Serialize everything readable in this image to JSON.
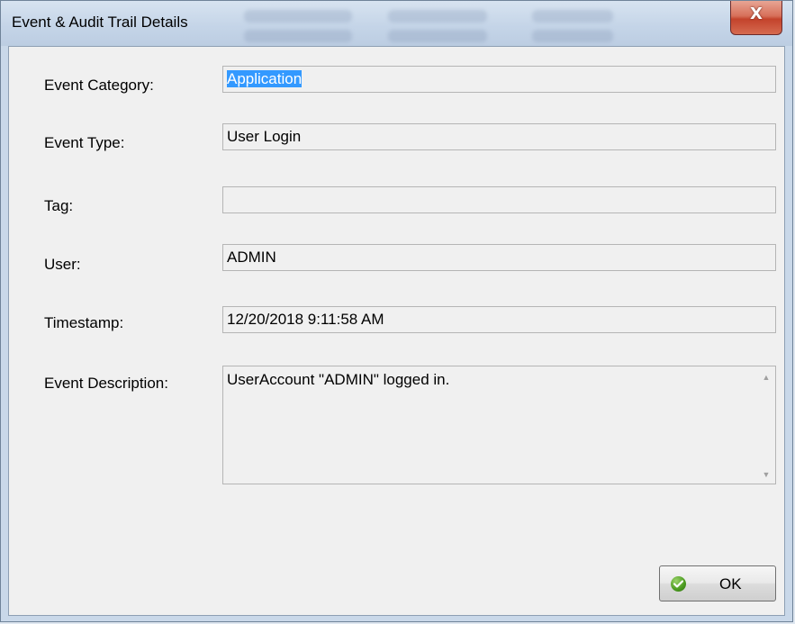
{
  "window": {
    "title": "Event & Audit Trail Details",
    "close_glyph": "X"
  },
  "fields": {
    "event_category": {
      "label": "Event Category:",
      "value": "Application"
    },
    "event_type": {
      "label": "Event Type:",
      "value": "User Login"
    },
    "tag": {
      "label": "Tag:",
      "value": ""
    },
    "user": {
      "label": "User:",
      "value": "ADMIN"
    },
    "timestamp": {
      "label": "Timestamp:",
      "value": "12/20/2018 9:11:58 AM"
    },
    "event_description": {
      "label": "Event Description:",
      "value": "UserAccount \"ADMIN\" logged in."
    }
  },
  "scroll": {
    "up_glyph": "▲",
    "down_glyph": "▼"
  },
  "buttons": {
    "ok_label": "OK",
    "ok_icon": "check-circle-icon"
  },
  "colors": {
    "selection": "#3399ff",
    "ok_icon_green": "#4a9a1f",
    "close_red": "#c4432c"
  }
}
